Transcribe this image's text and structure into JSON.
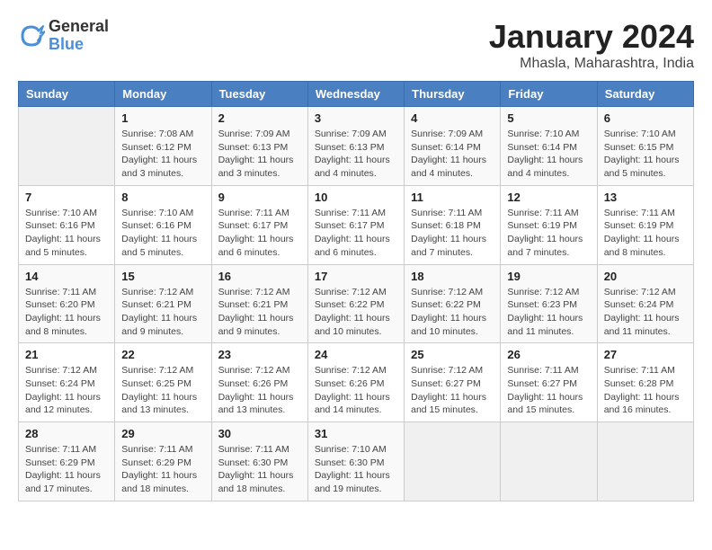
{
  "logo": {
    "general": "General",
    "blue": "Blue"
  },
  "title": "January 2024",
  "location": "Mhasla, Maharashtra, India",
  "days_of_week": [
    "Sunday",
    "Monday",
    "Tuesday",
    "Wednesday",
    "Thursday",
    "Friday",
    "Saturday"
  ],
  "weeks": [
    [
      {
        "day": "",
        "info": ""
      },
      {
        "day": "1",
        "info": "Sunrise: 7:08 AM\nSunset: 6:12 PM\nDaylight: 11 hours\nand 3 minutes."
      },
      {
        "day": "2",
        "info": "Sunrise: 7:09 AM\nSunset: 6:13 PM\nDaylight: 11 hours\nand 3 minutes."
      },
      {
        "day": "3",
        "info": "Sunrise: 7:09 AM\nSunset: 6:13 PM\nDaylight: 11 hours\nand 4 minutes."
      },
      {
        "day": "4",
        "info": "Sunrise: 7:09 AM\nSunset: 6:14 PM\nDaylight: 11 hours\nand 4 minutes."
      },
      {
        "day": "5",
        "info": "Sunrise: 7:10 AM\nSunset: 6:14 PM\nDaylight: 11 hours\nand 4 minutes."
      },
      {
        "day": "6",
        "info": "Sunrise: 7:10 AM\nSunset: 6:15 PM\nDaylight: 11 hours\nand 5 minutes."
      }
    ],
    [
      {
        "day": "7",
        "info": "Sunrise: 7:10 AM\nSunset: 6:16 PM\nDaylight: 11 hours\nand 5 minutes."
      },
      {
        "day": "8",
        "info": "Sunrise: 7:10 AM\nSunset: 6:16 PM\nDaylight: 11 hours\nand 5 minutes."
      },
      {
        "day": "9",
        "info": "Sunrise: 7:11 AM\nSunset: 6:17 PM\nDaylight: 11 hours\nand 6 minutes."
      },
      {
        "day": "10",
        "info": "Sunrise: 7:11 AM\nSunset: 6:17 PM\nDaylight: 11 hours\nand 6 minutes."
      },
      {
        "day": "11",
        "info": "Sunrise: 7:11 AM\nSunset: 6:18 PM\nDaylight: 11 hours\nand 7 minutes."
      },
      {
        "day": "12",
        "info": "Sunrise: 7:11 AM\nSunset: 6:19 PM\nDaylight: 11 hours\nand 7 minutes."
      },
      {
        "day": "13",
        "info": "Sunrise: 7:11 AM\nSunset: 6:19 PM\nDaylight: 11 hours\nand 8 minutes."
      }
    ],
    [
      {
        "day": "14",
        "info": "Sunrise: 7:11 AM\nSunset: 6:20 PM\nDaylight: 11 hours\nand 8 minutes."
      },
      {
        "day": "15",
        "info": "Sunrise: 7:12 AM\nSunset: 6:21 PM\nDaylight: 11 hours\nand 9 minutes."
      },
      {
        "day": "16",
        "info": "Sunrise: 7:12 AM\nSunset: 6:21 PM\nDaylight: 11 hours\nand 9 minutes."
      },
      {
        "day": "17",
        "info": "Sunrise: 7:12 AM\nSunset: 6:22 PM\nDaylight: 11 hours\nand 10 minutes."
      },
      {
        "day": "18",
        "info": "Sunrise: 7:12 AM\nSunset: 6:22 PM\nDaylight: 11 hours\nand 10 minutes."
      },
      {
        "day": "19",
        "info": "Sunrise: 7:12 AM\nSunset: 6:23 PM\nDaylight: 11 hours\nand 11 minutes."
      },
      {
        "day": "20",
        "info": "Sunrise: 7:12 AM\nSunset: 6:24 PM\nDaylight: 11 hours\nand 11 minutes."
      }
    ],
    [
      {
        "day": "21",
        "info": "Sunrise: 7:12 AM\nSunset: 6:24 PM\nDaylight: 11 hours\nand 12 minutes."
      },
      {
        "day": "22",
        "info": "Sunrise: 7:12 AM\nSunset: 6:25 PM\nDaylight: 11 hours\nand 13 minutes."
      },
      {
        "day": "23",
        "info": "Sunrise: 7:12 AM\nSunset: 6:26 PM\nDaylight: 11 hours\nand 13 minutes."
      },
      {
        "day": "24",
        "info": "Sunrise: 7:12 AM\nSunset: 6:26 PM\nDaylight: 11 hours\nand 14 minutes."
      },
      {
        "day": "25",
        "info": "Sunrise: 7:12 AM\nSunset: 6:27 PM\nDaylight: 11 hours\nand 15 minutes."
      },
      {
        "day": "26",
        "info": "Sunrise: 7:11 AM\nSunset: 6:27 PM\nDaylight: 11 hours\nand 15 minutes."
      },
      {
        "day": "27",
        "info": "Sunrise: 7:11 AM\nSunset: 6:28 PM\nDaylight: 11 hours\nand 16 minutes."
      }
    ],
    [
      {
        "day": "28",
        "info": "Sunrise: 7:11 AM\nSunset: 6:29 PM\nDaylight: 11 hours\nand 17 minutes."
      },
      {
        "day": "29",
        "info": "Sunrise: 7:11 AM\nSunset: 6:29 PM\nDaylight: 11 hours\nand 18 minutes."
      },
      {
        "day": "30",
        "info": "Sunrise: 7:11 AM\nSunset: 6:30 PM\nDaylight: 11 hours\nand 18 minutes."
      },
      {
        "day": "31",
        "info": "Sunrise: 7:10 AM\nSunset: 6:30 PM\nDaylight: 11 hours\nand 19 minutes."
      },
      {
        "day": "",
        "info": ""
      },
      {
        "day": "",
        "info": ""
      },
      {
        "day": "",
        "info": ""
      }
    ]
  ]
}
